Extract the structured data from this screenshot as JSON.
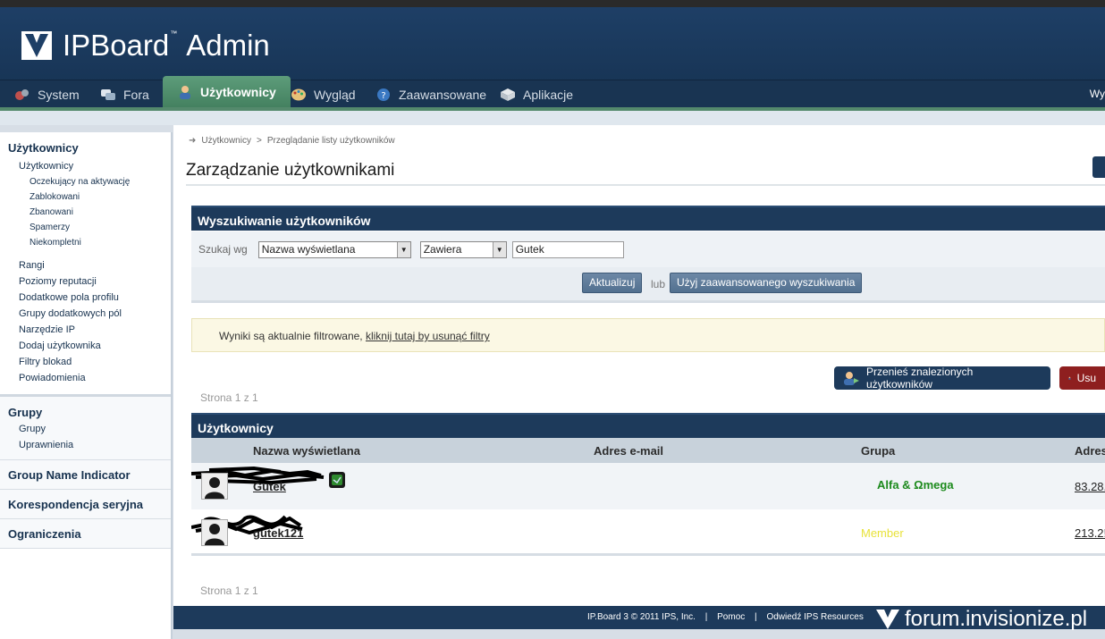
{
  "header": {
    "brand": "IPBoard",
    "tm": "™",
    "admin": "Admin",
    "right_user": "Wy"
  },
  "nav": {
    "items": [
      {
        "label": "System",
        "icon": "system-icon"
      },
      {
        "label": "Fora",
        "icon": "forums-icon"
      },
      {
        "label": "Użytkownicy",
        "icon": "members-icon",
        "active": true
      },
      {
        "label": "Wygląd",
        "icon": "palette-icon"
      },
      {
        "label": "Zaawansowane",
        "icon": "question-icon"
      },
      {
        "label": "Aplikacje",
        "icon": "apps-icon"
      }
    ]
  },
  "sidebar": {
    "sections": [
      {
        "title": "Użytkownicy",
        "items": [
          {
            "label": "Użytkownicy",
            "level": 1
          },
          {
            "label": "Oczekujący na aktywację",
            "level": 2
          },
          {
            "label": "Zablokowani",
            "level": 2
          },
          {
            "label": "Zbanowani",
            "level": 2
          },
          {
            "label": "Spamerzy",
            "level": 2
          },
          {
            "label": "Niekompletni",
            "level": 2
          },
          {
            "label": "Rangi",
            "level": 1
          },
          {
            "label": "Poziomy reputacji",
            "level": 1
          },
          {
            "label": "Dodatkowe pola profilu",
            "level": 1
          },
          {
            "label": "Grupy dodatkowych pól",
            "level": 1
          },
          {
            "label": "Narzędzie IP",
            "level": 1
          },
          {
            "label": "Dodaj użytkownika",
            "level": 1
          },
          {
            "label": "Filtry blokad",
            "level": 1
          },
          {
            "label": "Powiadomienia",
            "level": 1
          }
        ]
      },
      {
        "title": "Grupy",
        "items": [
          {
            "label": "Grupy",
            "level": 1
          },
          {
            "label": "Uprawnienia",
            "level": 1
          }
        ]
      },
      {
        "title": "Group Name Indicator",
        "items": []
      },
      {
        "title": "Korespondencja seryjna",
        "items": []
      },
      {
        "title": "Ograniczenia",
        "items": []
      }
    ]
  },
  "breadcrumb": {
    "root": "Użytkownicy",
    "sep": ">",
    "current": "Przeglądanie listy użytkowników"
  },
  "page_title": "Zarządzanie użytkownikami",
  "search": {
    "title": "Wyszukiwanie użytkowników",
    "label": "Szukaj wg",
    "field_select": "Nazwa wyświetlana",
    "mode_select": "Zawiera",
    "query": "Gutek",
    "update_button": "Aktualizuj",
    "or": "lub",
    "advanced_button": "Użyj zaawansowanego wyszukiwania"
  },
  "notice": {
    "text": "Wyniki są aktualnie filtrowane, ",
    "link": "kliknij tutaj by usunąć filtry"
  },
  "actions": {
    "move_button": "Przenieś znalezionych użytkowników",
    "delete_button": "Usu"
  },
  "pagination": {
    "top": "Strona 1 z 1",
    "bottom": "Strona 1 z 1"
  },
  "members": {
    "title": "Użytkownicy",
    "columns": [
      "Nazwa wyświetlana",
      "Adres e-mail",
      "Grupa",
      "Adres"
    ],
    "rows": [
      {
        "name": "Gutek",
        "group": "Alfa & Ωmega",
        "ip": "83.28."
      },
      {
        "name": "gutek121",
        "group": "Member",
        "ip": "213.2!"
      }
    ]
  },
  "footer": {
    "copyright": "IP.Board 3 © 2011 IPS, Inc.",
    "sep": "|",
    "help": "Pomoc",
    "visit": "Odwiedź IPS Resources"
  },
  "watermark": "forum.invisionize.pl",
  "colors": {
    "navy": "#1d3a5b",
    "green_tab": "#4b8a6a",
    "group_admin": "#1c8a1c",
    "group_member": "#e8e23a"
  }
}
